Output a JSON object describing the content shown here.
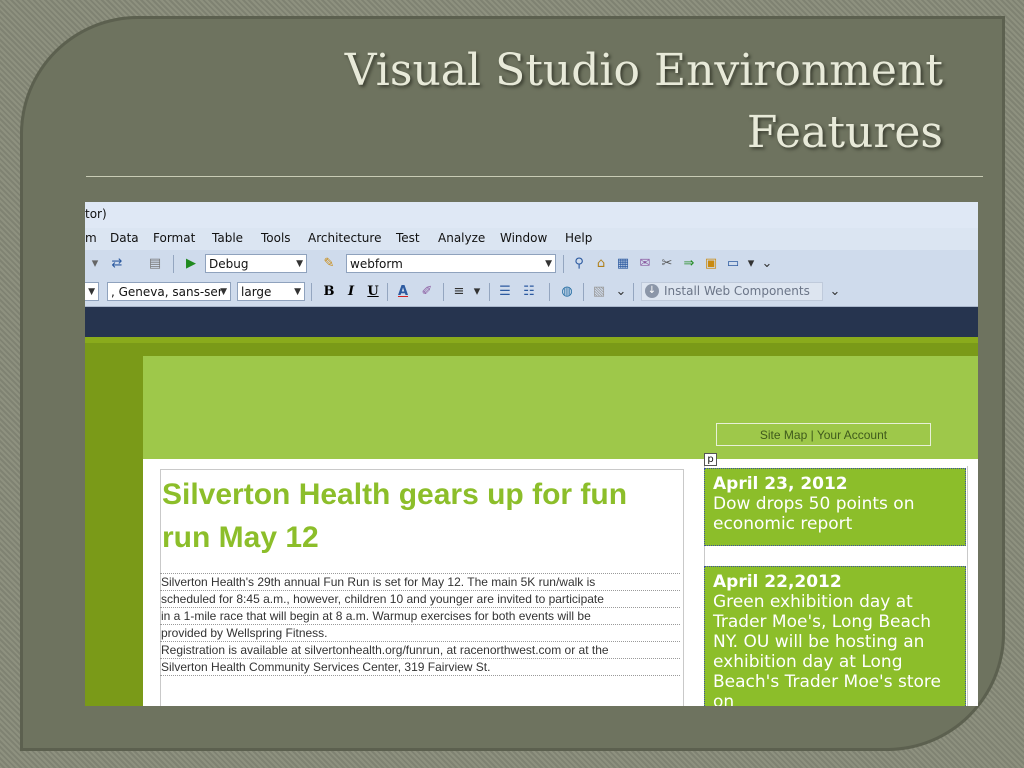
{
  "slide": {
    "title_line1": "Visual Studio Environment",
    "title_line2": "Features"
  },
  "window": {
    "title_fragment": "tor)"
  },
  "menu": [
    "m",
    "Data",
    "Format",
    "Table",
    "Tools",
    "Architecture",
    "Test",
    "Analyze",
    "Window",
    "Help"
  ],
  "toolbar1": {
    "config_value": "Debug",
    "project_value": "webform"
  },
  "toolbar2": {
    "font_value": ", Geneva, sans-ser",
    "size_value": "large",
    "bold": "B",
    "italic": "I",
    "underline": "U",
    "install_label": "Install Web Components"
  },
  "page": {
    "sitemap": "Site Map | Your Account",
    "p_tag": "p",
    "headline": "Silverton Health gears up for fun run May 12",
    "body_lines": [
      "Silverton Health's 29th annual Fun Run is set for May 12. The main 5K run/walk is",
      "scheduled for 8:45 a.m., however, children 10 and younger are invited to participate",
      "in a 1-mile race that will begin at 8 a.m. Warmup exercises for both events will be",
      "provided by Wellspring Fitness.",
      "Registration is available at silvertonhealth.org/funrun, at racenorthwest.com or at the",
      "Silverton Health Community Services Center, 319 Fairview St."
    ],
    "news": [
      {
        "date": "April 23, 2012",
        "text": "Dow drops 50 points on economic report"
      },
      {
        "date": "April 22,2012",
        "text": "Green exhibition day at Trader Moe's, Long Beach NY. OU will be hosting an exhibition day at Long Beach's Trader Moe's store on"
      }
    ]
  },
  "colors": {
    "accent_green": "#8cbe2a",
    "navy_bar": "#26344f",
    "slide_bg": "#6e735f"
  }
}
